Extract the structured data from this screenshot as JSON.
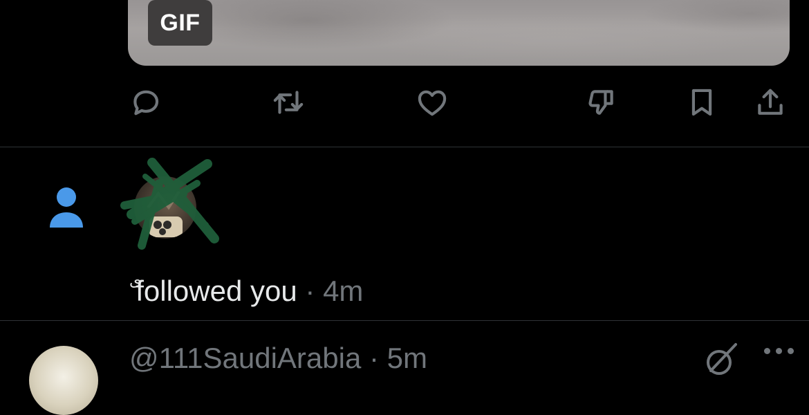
{
  "media": {
    "badge_label": "GIF"
  },
  "actions": [
    {
      "name": "reply",
      "icon": "reply-icon"
    },
    {
      "name": "repost",
      "icon": "repost-icon"
    },
    {
      "name": "like",
      "icon": "heart-icon"
    },
    {
      "name": "dislike",
      "icon": "thumbs-down-icon"
    },
    {
      "name": "bookmark",
      "icon": "bookmark-icon"
    },
    {
      "name": "share",
      "icon": "share-icon"
    }
  ],
  "notification": {
    "type_icon": "person-icon",
    "glyph": "ى",
    "text": "followed you",
    "separator": "·",
    "time": "4m"
  },
  "next_item": {
    "handle": "@111SaudiArabia",
    "separator": "·",
    "time": "5m"
  },
  "colors": {
    "background": "#000000",
    "text_primary": "#e7e9ea",
    "text_secondary": "#71767b",
    "divider": "#2f3336",
    "accent_blue": "#4a99e9",
    "scribble_green": "#1f5e3a"
  }
}
